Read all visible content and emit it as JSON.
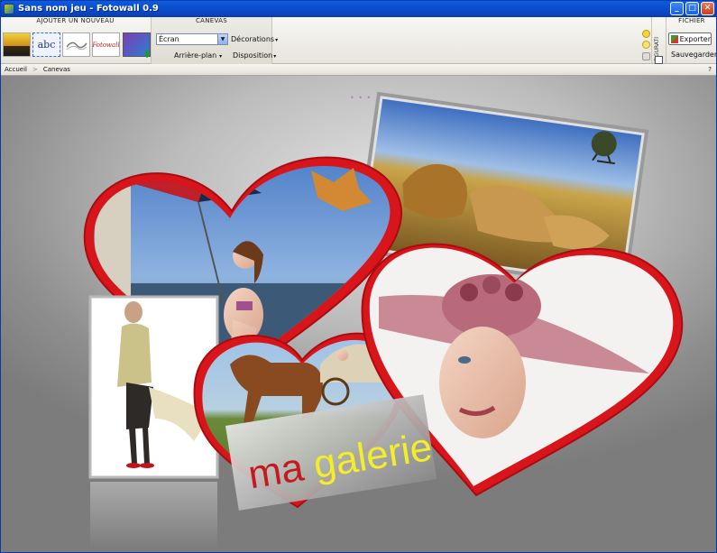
{
  "window": {
    "title": "Sans nom jeu - Fotowall 0.9",
    "minimize": "_",
    "maximize": "□",
    "close": "✕"
  },
  "ribbon": {
    "add_group": {
      "title": "AJOUTER UN NOUVEAU",
      "text_item": "abc",
      "logo_item": "Fotowall"
    },
    "canvas_group": {
      "title": "CANEVAS",
      "view_mode": {
        "selected": "Écran"
      },
      "decorations": "Décorations",
      "background": "Arrière-plan",
      "layout": "Disposition"
    },
    "config_group": {
      "title": "CONFIGURATI"
    },
    "file_group": {
      "title": "FICHIER",
      "export": "Exporter",
      "save": "Sauvegarder"
    }
  },
  "breadcrumb": {
    "items": [
      "Accueil",
      "Canevas"
    ],
    "help": "?"
  },
  "canvas": {
    "title_text": {
      "part1": "ma",
      "part2": "galerie"
    },
    "decoration_dots": "• • •"
  },
  "colors": {
    "title_bar": "#0b4fd1",
    "heart_frame": "#d8151b",
    "text_red": "#c41a1f",
    "text_yellow": "#f2ee2a"
  }
}
